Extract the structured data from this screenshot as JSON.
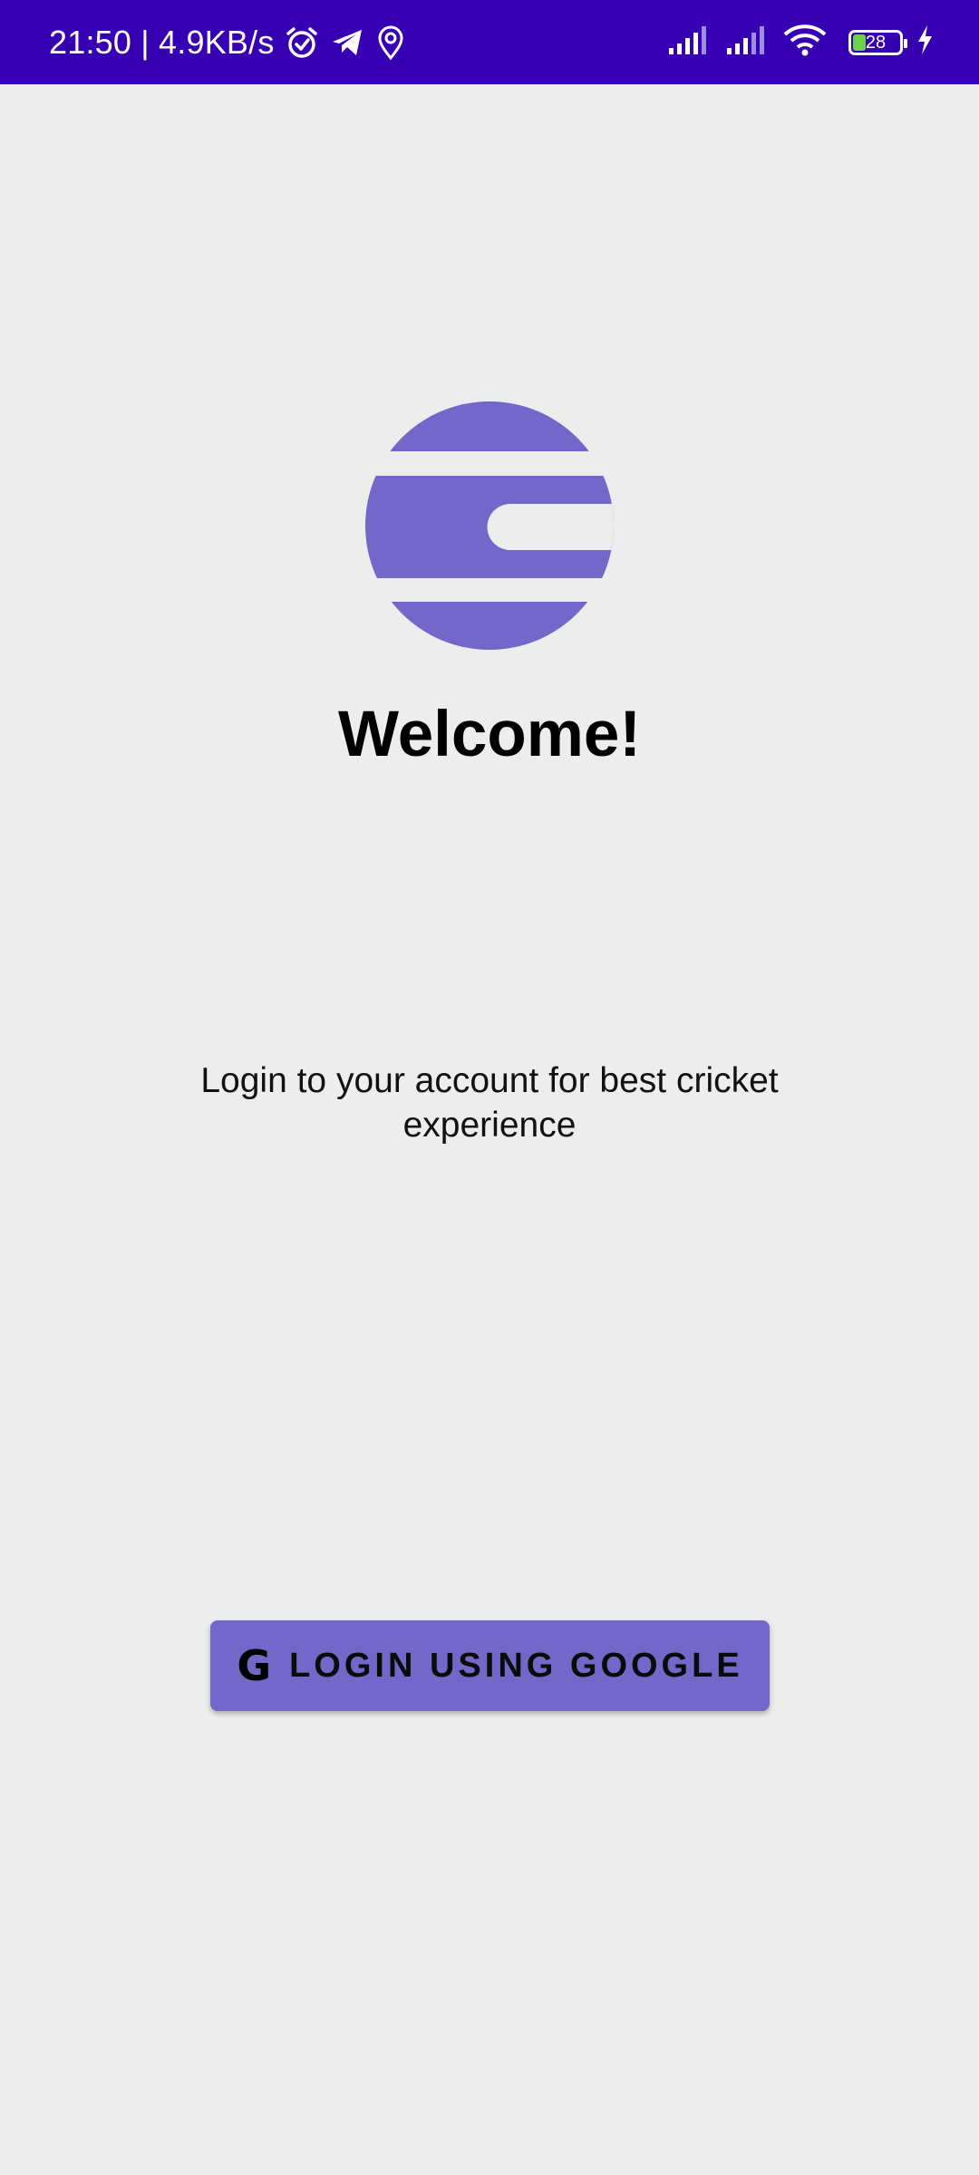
{
  "status_bar": {
    "time_speed": "21:50 | 4.9KB/s",
    "icons": [
      "alarm-icon",
      "telegram-icon",
      "location-icon",
      "signal-icon",
      "signal-icon",
      "wifi-icon",
      "battery-icon",
      "charging-icon"
    ],
    "battery_level": "28",
    "battery_fraction": 0.28,
    "background_color": "#3700b3"
  },
  "logo": {
    "icon": "app-logo",
    "color": "#7367c9"
  },
  "welcome": {
    "title": "Welcome!"
  },
  "subtitle": {
    "line1": "Login to your account for best cricket",
    "line2": "experience"
  },
  "login": {
    "icon": "google-icon",
    "icon_glyph": "G",
    "label": "LOGIN USING GOOGLE",
    "button_color": "#7367c9"
  }
}
